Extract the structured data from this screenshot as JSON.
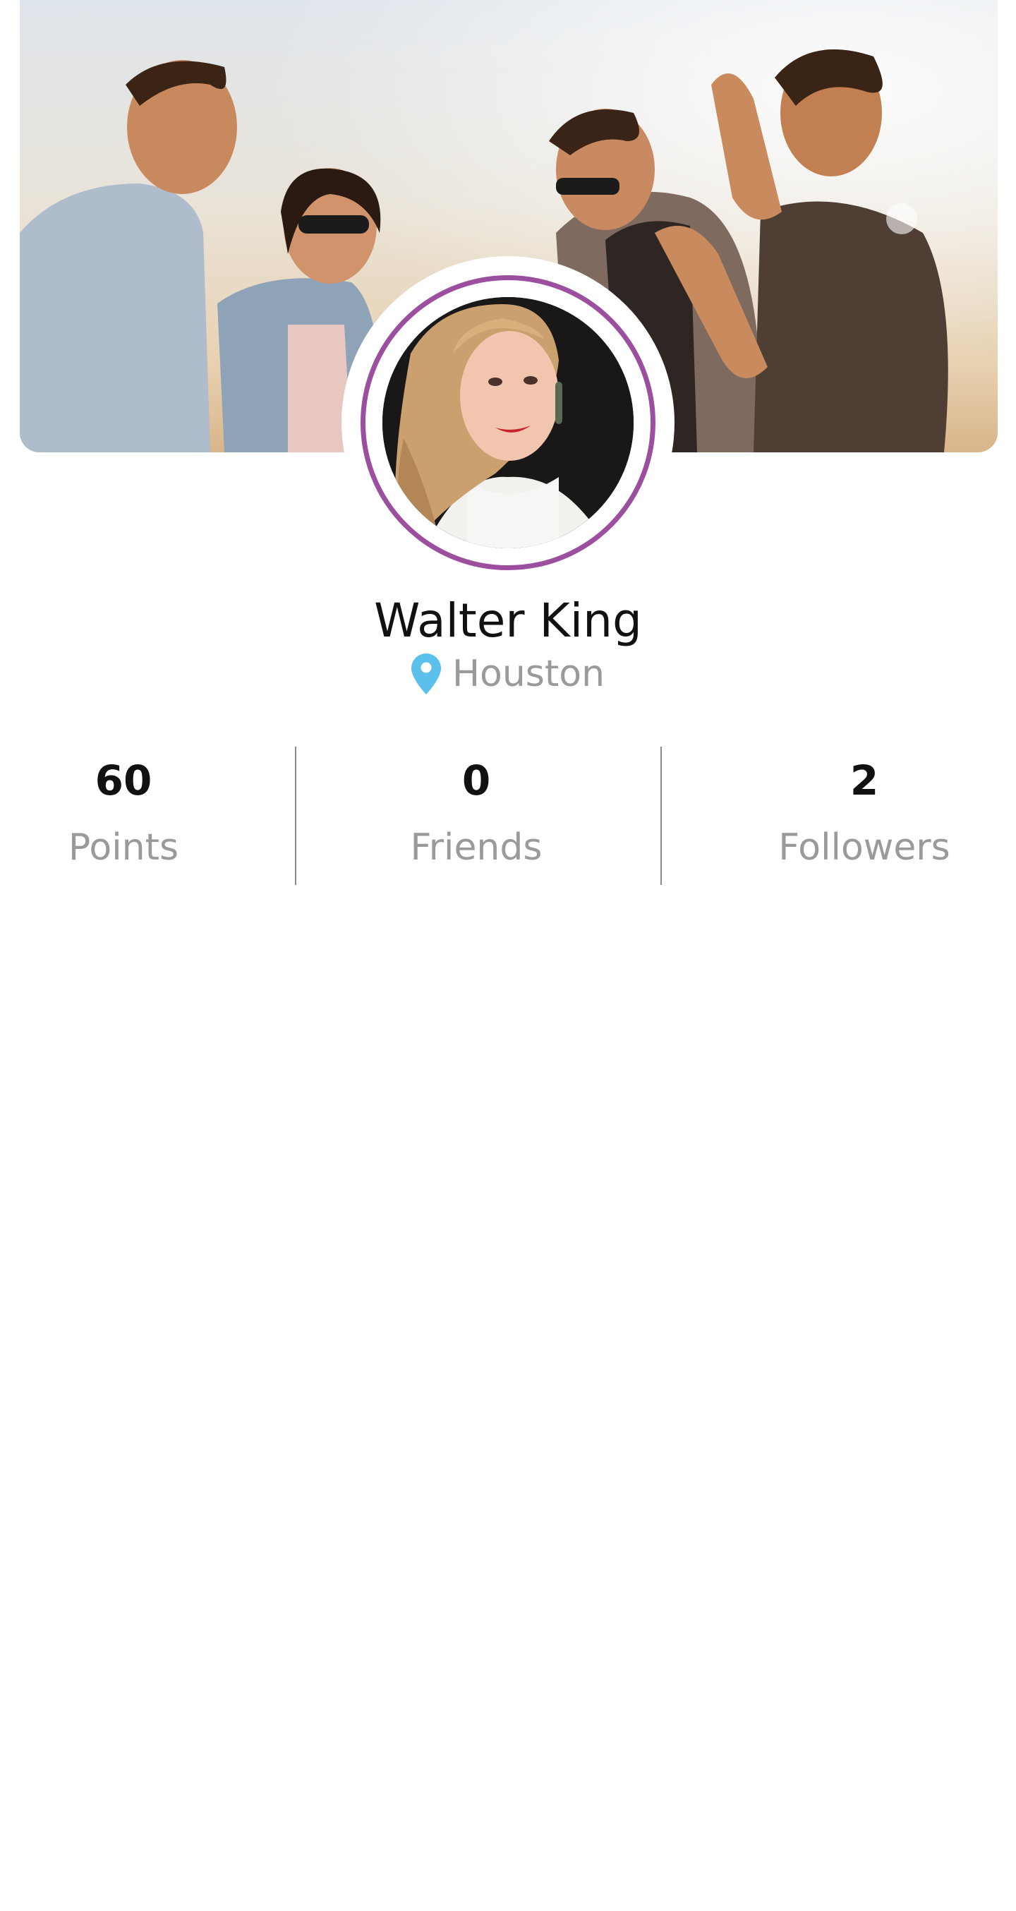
{
  "profile": {
    "name": "Walter King",
    "location": "Houston"
  },
  "stats": {
    "points": {
      "value": "60",
      "label": "Points"
    },
    "friends": {
      "value": "0",
      "label": "Friends"
    },
    "followers": {
      "value": "2",
      "label": "Followers"
    }
  },
  "colors": {
    "avatar_ring": "#9b4f9e",
    "location_pin": "#5bc0eb",
    "muted_text": "#9a9a9a",
    "primary_text": "#111111"
  },
  "icons": {
    "location": "map-pin-icon"
  }
}
